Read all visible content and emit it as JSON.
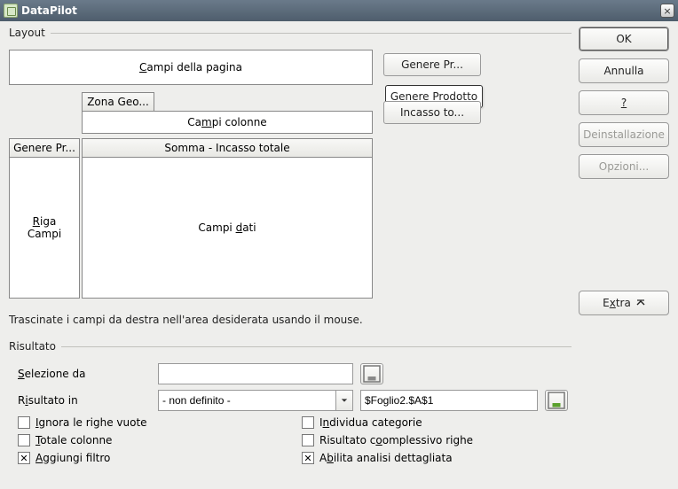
{
  "window": {
    "title": "DataPilot"
  },
  "buttons": {
    "ok": "OK",
    "cancel": "Annulla",
    "help": "?",
    "uninstall": "Deinstallazione",
    "options": "Opzioni...",
    "extra": "Extra"
  },
  "layout": {
    "legend": "Layout",
    "page_fields": "Campi della pagina",
    "column_fields": "Campi colonne",
    "row_fields_line1": "Riga",
    "row_fields_line2": "Campi",
    "data_fields": "Campi dati",
    "col_header_zone": "Zona Geo...",
    "row_header_genre": "Genere Pr...",
    "data_header_sum": "Somma - Incasso totale",
    "hint": "Trascinate i campi da destra nell'area desiderata usando il mouse.",
    "available": {
      "genre": "Genere Pr...",
      "zone_overlay": "Genere Prodotto",
      "income": "Incasso to..."
    }
  },
  "result": {
    "legend": "Risultato",
    "selection_from": "Selezione da",
    "result_in": "Risultato in",
    "result_in_combo": "- non definito -",
    "result_in_value": "$Foglio2.$A$1",
    "checks": {
      "ignore_empty": "Ignora le righe vuote",
      "detect_cat": "Individua categorie",
      "total_cols": "Totale colonne",
      "total_rows": "Risultato complessivo righe",
      "add_filter": "Aggiungi filtro",
      "drill": "Abilita analisi dettagliata"
    },
    "checked": {
      "ignore_empty": false,
      "detect_cat": false,
      "total_cols": false,
      "total_rows": false,
      "add_filter": true,
      "drill": true
    }
  }
}
